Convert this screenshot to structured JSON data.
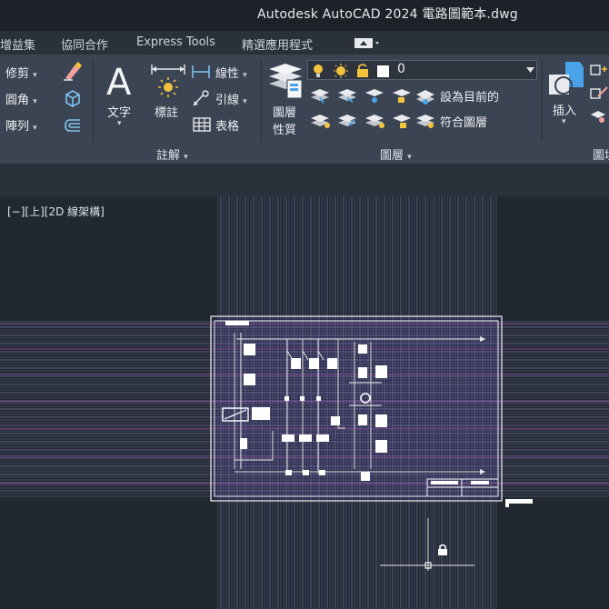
{
  "window": {
    "title": "Autodesk AutoCAD 2024    電路圖範本.dwg"
  },
  "tabs": [
    {
      "label": "增益集"
    },
    {
      "label": "協同合作"
    },
    {
      "label": "Express Tools"
    },
    {
      "label": "精選應用程式"
    }
  ],
  "ribbon": {
    "modify": {
      "trim_label": "修剪",
      "fillet_label": "圓角",
      "array_label": "陣列"
    },
    "annotation": {
      "text_label": "文字",
      "dimension_label": "標註",
      "linear_label": "線性",
      "leader_label": "引線",
      "table_label": "表格",
      "panel_title": "註解"
    },
    "layers": {
      "properties_label_line1": "圖層",
      "properties_label_line2": "性質",
      "current_layer": "0",
      "make_current_label": "設為目前的",
      "match_layer_label": "符合圖層",
      "panel_title": "圖層"
    },
    "block": {
      "insert_label": "插入",
      "panel_title_partial": "圖塊"
    },
    "colors": {
      "ribbon_bg": "#3b4453",
      "titlebar_bg": "#1e2228",
      "viewport_bg": "#212830",
      "accent_yellow": "#f2c43d",
      "accent_blue": "#4aa3e8"
    }
  },
  "viewport": {
    "view_label": "[−][上][2D 線架構]"
  }
}
